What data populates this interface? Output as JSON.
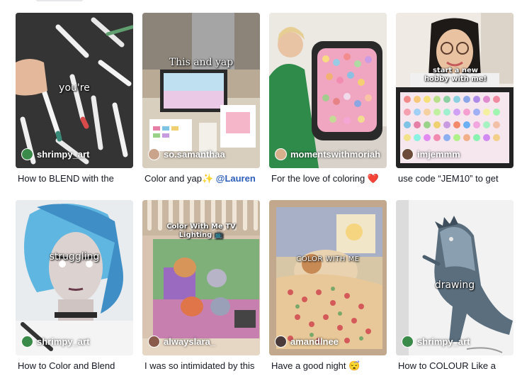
{
  "videos": [
    {
      "overlay": "you're",
      "author": "shrimpy_art",
      "caption": "How to BLEND with the",
      "avatar_color": "#3a8a4a"
    },
    {
      "overlay": "This and yap",
      "author": "so.samanthaa",
      "caption": "Color and yap✨",
      "caption_mention": "@Lauren",
      "avatar_color": "#c9a38a"
    },
    {
      "overlay": "",
      "author": "momentswithmoriah",
      "caption": "For the love of coloring",
      "caption_emoji": "❤️",
      "avatar_color": "#d8b08c"
    },
    {
      "overlay": "start a new hobby with me!",
      "author": "imjemmm",
      "caption": "use code “JEM10” to get",
      "avatar_color": "#6d4b3b"
    },
    {
      "overlay": "struggling",
      "author": "shrimpy_art",
      "caption": "How to Color and Blend",
      "avatar_color": "#3a8a4a"
    },
    {
      "overlay": "Color With Me TV Lighting 📺",
      "author": "alwayslara_",
      "caption": "I was so intimidated by this",
      "avatar_color": "#8a5a4a"
    },
    {
      "overlay": "COLOR WITH ME",
      "author": "amandlnee",
      "caption": "Have a good night",
      "caption_emoji": "😴",
      "avatar_color": "#4a3a3a"
    },
    {
      "overlay": "drawing",
      "author": "shrimpy_art",
      "caption": "How to COLOUR Like a",
      "avatar_color": "#3a8a4a"
    }
  ],
  "colors": {
    "text": "#161823",
    "mention": "#2b5db9",
    "heart": "#fe2c55"
  }
}
